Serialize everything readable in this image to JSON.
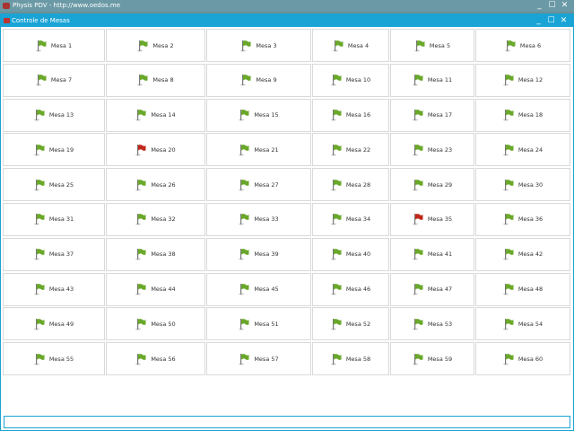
{
  "app": {
    "outer_title": "Physis PDV - http://www.oedos.me",
    "inner_title": "Controle de Mesas"
  },
  "window_buttons": {
    "minimize": "_",
    "maximize": "☐",
    "close": "✕"
  },
  "colors": {
    "free": "#6aa82a",
    "occupied": "#c0281c",
    "accent": "#1aa4d6"
  },
  "tables": [
    {
      "label": "Mesa 1",
      "status": "free"
    },
    {
      "label": "Mesa 2",
      "status": "free"
    },
    {
      "label": "Mesa 3",
      "status": "free"
    },
    {
      "label": "Mesa 4",
      "status": "free"
    },
    {
      "label": "Mesa 5",
      "status": "free"
    },
    {
      "label": "Mesa 6",
      "status": "free"
    },
    {
      "label": "Mesa 7",
      "status": "free"
    },
    {
      "label": "Mesa 8",
      "status": "free"
    },
    {
      "label": "Mesa 9",
      "status": "free"
    },
    {
      "label": "Mesa 10",
      "status": "free"
    },
    {
      "label": "Mesa 11",
      "status": "free"
    },
    {
      "label": "Mesa 12",
      "status": "free"
    },
    {
      "label": "Mesa 13",
      "status": "free"
    },
    {
      "label": "Mesa 14",
      "status": "free"
    },
    {
      "label": "Mesa 15",
      "status": "free"
    },
    {
      "label": "Mesa 16",
      "status": "free"
    },
    {
      "label": "Mesa 17",
      "status": "free"
    },
    {
      "label": "Mesa 18",
      "status": "free"
    },
    {
      "label": "Mesa 19",
      "status": "free"
    },
    {
      "label": "Mesa 20",
      "status": "occupied"
    },
    {
      "label": "Mesa 21",
      "status": "free"
    },
    {
      "label": "Mesa 22",
      "status": "free"
    },
    {
      "label": "Mesa 23",
      "status": "free"
    },
    {
      "label": "Mesa 24",
      "status": "free"
    },
    {
      "label": "Mesa 25",
      "status": "free"
    },
    {
      "label": "Mesa 26",
      "status": "free"
    },
    {
      "label": "Mesa 27",
      "status": "free"
    },
    {
      "label": "Mesa 28",
      "status": "free"
    },
    {
      "label": "Mesa 29",
      "status": "free"
    },
    {
      "label": "Mesa 30",
      "status": "free"
    },
    {
      "label": "Mesa 31",
      "status": "free"
    },
    {
      "label": "Mesa 32",
      "status": "free"
    },
    {
      "label": "Mesa 33",
      "status": "free"
    },
    {
      "label": "Mesa 34",
      "status": "free"
    },
    {
      "label": "Mesa 35",
      "status": "occupied"
    },
    {
      "label": "Mesa 36",
      "status": "free"
    },
    {
      "label": "Mesa 37",
      "status": "free"
    },
    {
      "label": "Mesa 38",
      "status": "free"
    },
    {
      "label": "Mesa 39",
      "status": "free"
    },
    {
      "label": "Mesa 40",
      "status": "free"
    },
    {
      "label": "Mesa 41",
      "status": "free"
    },
    {
      "label": "Mesa 42",
      "status": "free"
    },
    {
      "label": "Mesa 43",
      "status": "free"
    },
    {
      "label": "Mesa 44",
      "status": "free"
    },
    {
      "label": "Mesa 45",
      "status": "free"
    },
    {
      "label": "Mesa 46",
      "status": "free"
    },
    {
      "label": "Mesa 47",
      "status": "free"
    },
    {
      "label": "Mesa 48",
      "status": "free"
    },
    {
      "label": "Mesa 49",
      "status": "free"
    },
    {
      "label": "Mesa 50",
      "status": "free"
    },
    {
      "label": "Mesa 51",
      "status": "free"
    },
    {
      "label": "Mesa 52",
      "status": "free"
    },
    {
      "label": "Mesa 53",
      "status": "free"
    },
    {
      "label": "Mesa 54",
      "status": "free"
    },
    {
      "label": "Mesa 55",
      "status": "free"
    },
    {
      "label": "Mesa 56",
      "status": "free"
    },
    {
      "label": "Mesa 57",
      "status": "free"
    },
    {
      "label": "Mesa 58",
      "status": "free"
    },
    {
      "label": "Mesa 59",
      "status": "free"
    },
    {
      "label": "Mesa 60",
      "status": "free"
    }
  ]
}
